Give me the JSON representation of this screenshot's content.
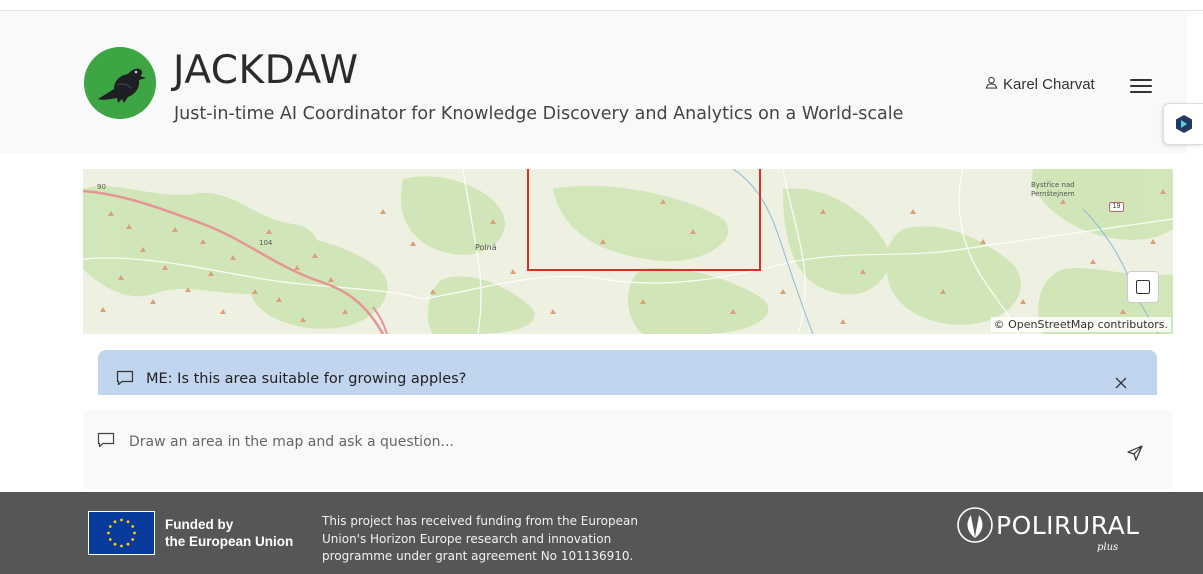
{
  "header": {
    "title": "JACKDAW",
    "subtitle": "Just-in-time AI Coordinator for Knowledge Discovery and Analytics on a World-scale",
    "user_name": "Karel Charvat",
    "icons": {
      "user": "user-icon",
      "menu": "hamburger-menu-icon",
      "side_tab": "assistant-icon",
      "logo": "jackdaw-bird-logo"
    }
  },
  "map": {
    "labels": {
      "polna": "Polná",
      "bystrice_line1": "Bystřice nad",
      "bystrice_line2": "Pernštejnem",
      "road_19": "19",
      "road_104": "104",
      "road_90": "90"
    },
    "attribution": "© OpenStreetMap contributors.",
    "selection_color": "#d63027",
    "icons": {
      "draw": "square-draw-icon"
    }
  },
  "chat": {
    "message": "ME: Is this area suitable for growing apples?",
    "message_bg": "#c2d5ee",
    "icons": {
      "message": "chat-bubble-icon",
      "close": "close-icon"
    }
  },
  "input": {
    "placeholder": "Draw an area in the map and ask a question...",
    "value": "",
    "icons": {
      "message": "chat-bubble-icon",
      "send": "send-icon"
    }
  },
  "footer": {
    "funded_line1": "Funded by",
    "funded_line2": "the European Union",
    "funding_text": "This project has received funding from the European Union's Horizon Europe research and innovation programme under grant agreement No 101136910.",
    "partner_logo_word": "POLIRURAL",
    "partner_logo_suffix": "plus",
    "bg_color": "#555657",
    "icons": {
      "eu_flag": "eu-flag-icon",
      "polirural": "polirural-leaf-logo"
    }
  }
}
